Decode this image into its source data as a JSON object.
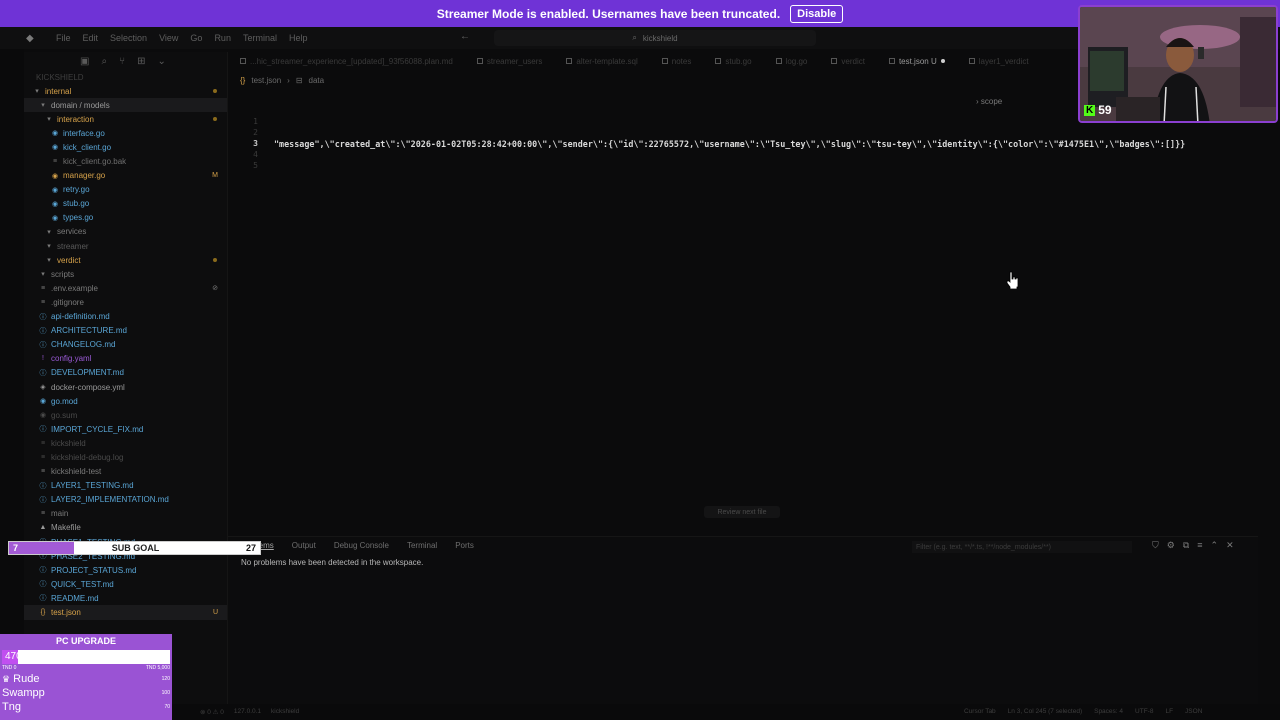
{
  "banner": {
    "text": "Streamer Mode is enabled. Usernames have been truncated.",
    "button": "Disable"
  },
  "titlebar": {
    "menu": [
      "File",
      "Edit",
      "Selection",
      "View",
      "Go",
      "Run",
      "Terminal",
      "Help"
    ],
    "command_center": "kickshield"
  },
  "explorer": {
    "project": "KICKSHIELD",
    "items": [
      {
        "label": "internal",
        "depth": 0,
        "kind": "folder",
        "color": "#d6a24a",
        "dot": "#8a6a1c"
      },
      {
        "label": "domain / models",
        "depth": 1,
        "kind": "folder",
        "color": "#9a9a9a",
        "selected": true
      },
      {
        "label": "interaction",
        "depth": 2,
        "kind": "folder",
        "color": "#d6a24a",
        "dot": "#8a6a1c"
      },
      {
        "label": "interface.go",
        "depth": 3,
        "kind": "go",
        "color": "#5aa6d6"
      },
      {
        "label": "kick_client.go",
        "depth": 3,
        "kind": "go",
        "color": "#5aa6d6"
      },
      {
        "label": "kick_client.go.bak",
        "depth": 3,
        "kind": "file",
        "color": "#6e6e6e"
      },
      {
        "label": "manager.go",
        "depth": 3,
        "kind": "go",
        "color": "#d6a24a",
        "badge": "M"
      },
      {
        "label": "retry.go",
        "depth": 3,
        "kind": "go",
        "color": "#5aa6d6"
      },
      {
        "label": "stub.go",
        "depth": 3,
        "kind": "go",
        "color": "#5aa6d6"
      },
      {
        "label": "types.go",
        "depth": 3,
        "kind": "go",
        "color": "#5aa6d6"
      },
      {
        "label": "services",
        "depth": 2,
        "kind": "folder",
        "color": "#7a7a7a"
      },
      {
        "label": "streamer",
        "depth": 2,
        "kind": "folder",
        "color": "#5a5a5a"
      },
      {
        "label": "verdict",
        "depth": 2,
        "kind": "folder",
        "color": "#d6a24a",
        "dot": "#8a6a1c"
      },
      {
        "label": "scripts",
        "depth": 1,
        "kind": "folder",
        "color": "#7a7a7a"
      },
      {
        "label": ".env.example",
        "depth": 1,
        "kind": "file",
        "color": "#7a7a7a",
        "badge": "⊘"
      },
      {
        "label": ".gitignore",
        "depth": 1,
        "kind": "file",
        "color": "#7a7a7a"
      },
      {
        "label": "api-definition.md",
        "depth": 1,
        "kind": "md",
        "color": "#5aa6d6"
      },
      {
        "label": "ARCHITECTURE.md",
        "depth": 1,
        "kind": "md",
        "color": "#5aa6d6"
      },
      {
        "label": "CHANGELOG.md",
        "depth": 1,
        "kind": "md",
        "color": "#5aa6d6"
      },
      {
        "label": "config.yaml",
        "depth": 1,
        "kind": "yaml",
        "color": "#9a5ad6"
      },
      {
        "label": "DEVELOPMENT.md",
        "depth": 1,
        "kind": "md",
        "color": "#5aa6d6"
      },
      {
        "label": "docker-compose.yml",
        "depth": 1,
        "kind": "docker",
        "color": "#9a9a9a"
      },
      {
        "label": "go.mod",
        "depth": 1,
        "kind": "go",
        "color": "#5aa6d6"
      },
      {
        "label": "go.sum",
        "depth": 1,
        "kind": "go",
        "color": "#4a4a4a"
      },
      {
        "label": "IMPORT_CYCLE_FIX.md",
        "depth": 1,
        "kind": "md",
        "color": "#5aa6d6"
      },
      {
        "label": "kickshield",
        "depth": 1,
        "kind": "file",
        "color": "#4a4a4a"
      },
      {
        "label": "kickshield-debug.log",
        "depth": 1,
        "kind": "file",
        "color": "#4a4a4a"
      },
      {
        "label": "kickshield-test",
        "depth": 1,
        "kind": "file",
        "color": "#7a7a7a"
      },
      {
        "label": "LAYER1_TESTING.md",
        "depth": 1,
        "kind": "md",
        "color": "#5aa6d6"
      },
      {
        "label": "LAYER2_IMPLEMENTATION.md",
        "depth": 1,
        "kind": "md",
        "color": "#5aa6d6"
      },
      {
        "label": "main",
        "depth": 1,
        "kind": "file",
        "color": "#7a7a7a"
      },
      {
        "label": "Makefile",
        "depth": 1,
        "kind": "make",
        "color": "#9a9a9a"
      },
      {
        "label": "PHASE1_TESTING.md",
        "depth": 1,
        "kind": "md",
        "color": "#5aa6d6"
      },
      {
        "label": "PHASE2_TESTING.md",
        "depth": 1,
        "kind": "md",
        "color": "#5aa6d6"
      },
      {
        "label": "PROJECT_STATUS.md",
        "depth": 1,
        "kind": "md",
        "color": "#5aa6d6"
      },
      {
        "label": "QUICK_TEST.md",
        "depth": 1,
        "kind": "md",
        "color": "#5aa6d6"
      },
      {
        "label": "README.md",
        "depth": 1,
        "kind": "md",
        "color": "#5aa6d6"
      },
      {
        "label": "test.json",
        "depth": 1,
        "kind": "json",
        "color": "#d6a24a",
        "badge": "U",
        "selected": true
      }
    ]
  },
  "tabs": [
    {
      "label": "...hic_streamer_experience_[updated]_93f56088.plan.md",
      "active": false
    },
    {
      "label": "streamer_users",
      "active": false
    },
    {
      "label": "alter-template.sql",
      "active": false
    },
    {
      "label": "notes",
      "active": false
    },
    {
      "label": "stub.go",
      "active": false
    },
    {
      "label": "log.go",
      "active": false
    },
    {
      "label": "verdict",
      "active": false
    },
    {
      "label": "test.json U",
      "active": true
    },
    {
      "label": "layer1_verdict",
      "active": false
    }
  ],
  "breadcrumb": [
    "test.json",
    "data"
  ],
  "editor": {
    "line_numbers": [
      "1",
      "2",
      "3",
      "4",
      "5"
    ],
    "current_line": "3",
    "code": "\"message\",\\\"created_at\\\":\\\"2026-01-02T05:28:42+00:00\\\",\\\"sender\\\":{\\\"id\\\":22765572,\\\"username\\\":\\\"Tsu_tey\\\",\\\"slug\\\":\\\"tsu-tey\\\",\\\"identity\\\":{\\\"color\\\":\\\"#1475E1\\\",\\\"badges\\\":[]}}",
    "scope": "scope",
    "review_button": "Review next file"
  },
  "panel": {
    "tabs": [
      "Problems",
      "Output",
      "Debug Console",
      "Terminal",
      "Ports"
    ],
    "active_tab": "Problems",
    "filter_placeholder": "Filter (e.g. text, **/*.ts, !**/node_modules/**)",
    "message": "No problems have been detected in the workspace."
  },
  "statusbar": {
    "left": [
      "⊗ 0 ⚠ 0",
      "127.0.0.1",
      "kickshield"
    ],
    "right": [
      "Cursor Tab",
      "Ln 3, Col 245 (7 selected)",
      "Spaces: 4",
      "UTF-8",
      "LF",
      "JSON"
    ]
  },
  "webcam": {
    "platform_icon": "K",
    "viewer_count": "59"
  },
  "sub_goal": {
    "current": "7",
    "title": "SUB GOAL",
    "goal": "27",
    "progress": 0.26
  },
  "pc_upgrade": {
    "title": "PC UPGRADE",
    "value": "470",
    "min_label": "TND 0",
    "max_label": "TND 5,000",
    "progress": 0.094,
    "donors": [
      {
        "name": "Rude",
        "amount": "120"
      },
      {
        "name": "Swampp",
        "amount": "100"
      },
      {
        "name": "Tng",
        "amount": "70"
      }
    ]
  },
  "colors": {
    "accent": "#6f33d6",
    "overlay": "#9a53d4",
    "kick_green": "#53fc18"
  }
}
